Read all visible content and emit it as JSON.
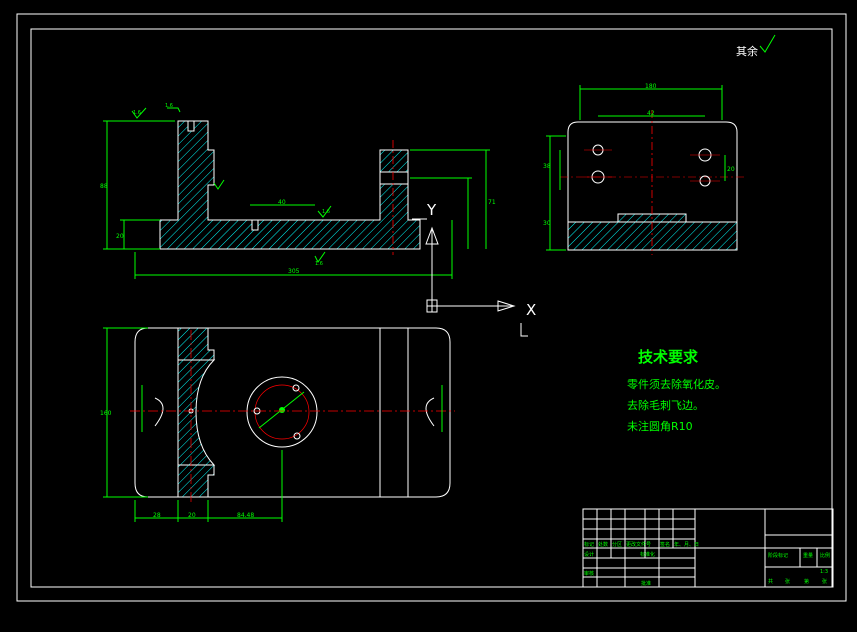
{
  "app": {
    "background": "#000000"
  },
  "colors": {
    "outline": "#ffffff",
    "dimension": "#00ff00",
    "centerline": "#ff0000",
    "hatch": "#00ffff",
    "ucs": "#ffffff"
  },
  "surface_note": {
    "label": "其余",
    "icon": "surface-roughness-icon"
  },
  "ucs": {
    "y_label": "Y",
    "x_label": "X"
  },
  "tech_requirements": {
    "title": "技术要求",
    "lines": [
      "零件须去除氧化皮。",
      "去除毛刺飞边。",
      "未注圆角R10"
    ]
  },
  "front_view": {
    "dims": {
      "overall_length": "305",
      "height_left": "88",
      "height_right": "71",
      "small_height": "20",
      "middle_width": "40",
      "roughness_bottom": "1.6",
      "roughness_slot": "1.6",
      "roughness_top": "1.6",
      "roughness_inner": "1.6"
    }
  },
  "side_view": {
    "dims": {
      "top_width": "180",
      "offset_a": "42",
      "offset_b": "38",
      "offset_c": "30",
      "offset_d": "20"
    }
  },
  "top_view": {
    "dims": {
      "overall_height": "160",
      "pitch_1": "28",
      "pitch_2": "20",
      "pitch_3": "84.48"
    }
  },
  "title_block": {
    "row_labels": [
      "标记",
      "处数",
      "分区",
      "更改文件号",
      "签名",
      "年、月、日"
    ],
    "design_labels": [
      "设计",
      "标准化"
    ],
    "check_labels": [
      "审核",
      "批准"
    ],
    "stage_labels": [
      "阶段标记",
      "重量",
      "比例"
    ],
    "scale": "1:3",
    "sheet_labels": [
      "共",
      "张",
      "第",
      "张"
    ]
  }
}
